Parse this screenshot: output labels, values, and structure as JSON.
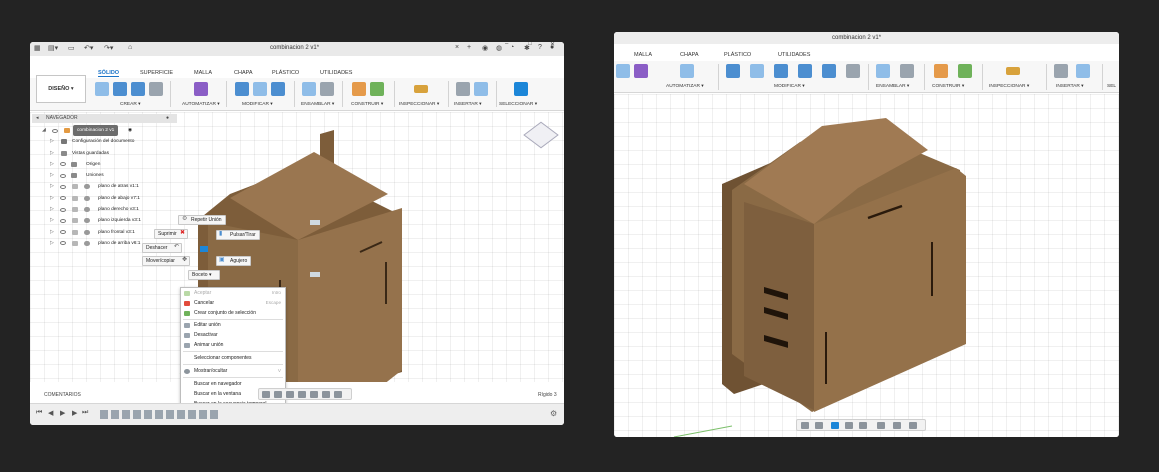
{
  "left_window": {
    "title": "combinacion 2 v1*",
    "tabs": [
      "SÓLIDO",
      "SUPERFICIE",
      "MALLA",
      "CHAPA",
      "PLÁSTICO",
      "UTILIDADES"
    ],
    "workspace_button": "DISEÑO ▾",
    "ribbon_groups": [
      "CREAR ▾",
      "AUTOMATIZAR ▾",
      "MODIFICAR ▾",
      "ENSAMBLAR ▾",
      "CONSTRUIR ▾",
      "INSPECCIONAR ▾",
      "INSERTAR ▾",
      "SELECCIONAR ▾"
    ],
    "browser": {
      "header": "NAVEGADOR",
      "root": "combinacion 2 v1",
      "items": [
        "Configuración del documento",
        "Vistas guardadas",
        "Origen",
        "Uniones",
        "plano de atras v1:1",
        "plano de abajo v7:1",
        "plano derecho v3:1",
        "plano izquierda v3:1",
        "plano frontal v3:1",
        "plano de arriba v6:1"
      ]
    },
    "marking_menu": {
      "repeat": "Repetir Unión",
      "delete": "Suprimir",
      "undo": "Deshacer",
      "move": "Mover/copiar",
      "press_pull": "Pulsar/Tirar",
      "hole": "Agujero",
      "sketch": "Boceto ▾"
    },
    "context_menu": {
      "accept": "Aceptar",
      "accept_key": "Intro",
      "cancel": "Cancelar",
      "cancel_key": "Escape",
      "create_selection_set": "Crear conjunto de selección",
      "edit_joint": "Editar unión",
      "deactivate": "Desactivar",
      "animate_joint": "Animar unión",
      "select_components": "Seleccionar componentes",
      "show_hide": "Mostrar/ocultar",
      "show_hide_key": "V",
      "find_in_browser": "Buscar en navegador",
      "find_in_window": "Buscar en la ventana",
      "find_in_timeline": "Buscar en la secuencia temporal"
    },
    "comments_label": "COMENTARIOS",
    "status_text": "Rígido 3"
  },
  "right_window": {
    "title": "combinacion 2 v1*",
    "tabs": [
      "MALLA",
      "CHAPA",
      "PLÁSTICO",
      "UTILIDADES"
    ],
    "ribbon_groups": [
      "AUTOMATIZAR ▾",
      "MODIFICAR ▾",
      "ENSAMBLAR ▾",
      "CONSTRUIR ▾",
      "INSPECCIONAR ▾",
      "INSERTAR ▾",
      "SEL"
    ]
  },
  "colors": {
    "accent": "#1a73c7",
    "wood": "#8a6a45",
    "background": "#232323"
  }
}
